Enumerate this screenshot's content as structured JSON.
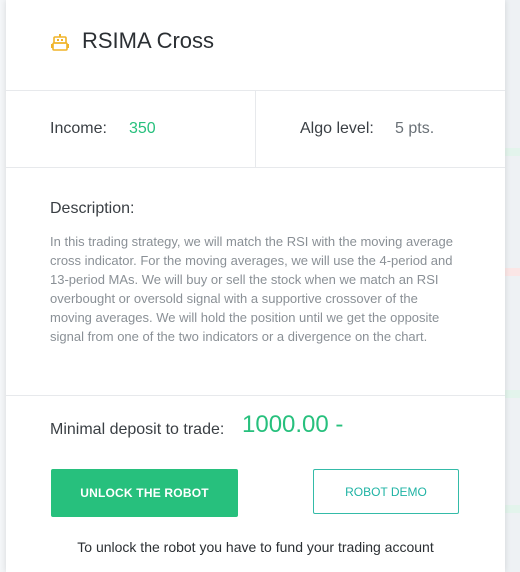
{
  "robot": {
    "icon": "robot-icon",
    "name": "RSIMA Cross"
  },
  "stats": {
    "income_label": "Income:",
    "income_value": "350",
    "algo_label": "Algo level:",
    "algo_value": "5 pts."
  },
  "description": {
    "label": "Description:",
    "text": "In this trading strategy, we will match the RSI with the moving average cross indicator. For the moving averages, we will use the 4-period and 13-period MAs. We will buy or sell the stock when we match an RSI overbought or oversold signal with a supportive crossover of the moving averages. We will hold the position until we get the opposite signal from one of the two indicators or a divergence on the chart."
  },
  "deposit": {
    "label": "Minimal deposit to trade:",
    "value": "1000.00 -"
  },
  "buttons": {
    "unlock": "UNLOCK THE ROBOT",
    "demo": "ROBOT DEMO"
  },
  "footer_note": "To unlock the robot you have to fund your trading account",
  "colors": {
    "accent_green": "#27c07d",
    "demo_teal": "#1fb3a4",
    "robot_icon": "#f0b429"
  }
}
